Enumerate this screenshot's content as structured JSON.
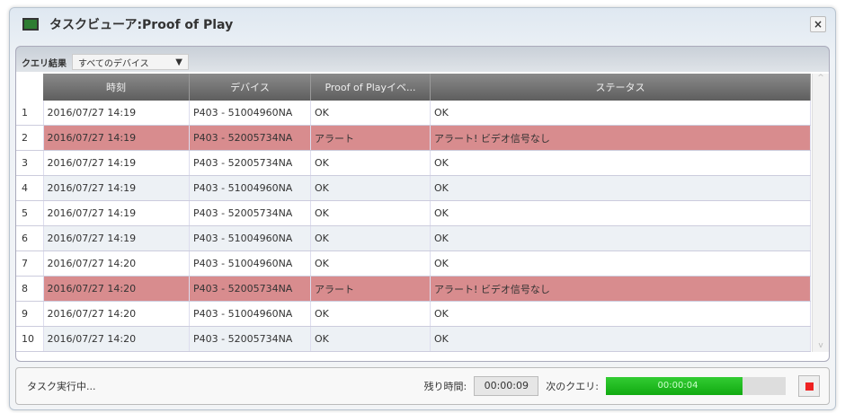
{
  "window": {
    "title": "タスクビューア:Proof of Play",
    "close": "×"
  },
  "toolbar": {
    "label": "クエリ結果",
    "device_select": "すべてのデバイス"
  },
  "table": {
    "headers": [
      "時刻",
      "デバイス",
      "Proof of Playイベ...",
      "ステータス"
    ],
    "rows": [
      {
        "n": "1",
        "time": "2016/07/27 14:19",
        "device": "P403 - 51004960NA",
        "event": "OK",
        "status": "OK",
        "alert": false
      },
      {
        "n": "2",
        "time": "2016/07/27 14:19",
        "device": "P403 - 52005734NA",
        "event": "アラート",
        "status": "アラート! ビデオ信号なし",
        "alert": true
      },
      {
        "n": "3",
        "time": "2016/07/27 14:19",
        "device": "P403 - 52005734NA",
        "event": "OK",
        "status": "OK",
        "alert": false
      },
      {
        "n": "4",
        "time": "2016/07/27 14:19",
        "device": "P403 - 51004960NA",
        "event": "OK",
        "status": "OK",
        "alert": false
      },
      {
        "n": "5",
        "time": "2016/07/27 14:19",
        "device": "P403 - 52005734NA",
        "event": "OK",
        "status": "OK",
        "alert": false
      },
      {
        "n": "6",
        "time": "2016/07/27 14:19",
        "device": "P403 - 51004960NA",
        "event": "OK",
        "status": "OK",
        "alert": false
      },
      {
        "n": "7",
        "time": "2016/07/27 14:20",
        "device": "P403 - 51004960NA",
        "event": "OK",
        "status": "OK",
        "alert": false
      },
      {
        "n": "8",
        "time": "2016/07/27 14:20",
        "device": "P403 - 52005734NA",
        "event": "アラート",
        "status": "アラート! ビデオ信号なし",
        "alert": true
      },
      {
        "n": "9",
        "time": "2016/07/27 14:20",
        "device": "P403 - 51004960NA",
        "event": "OK",
        "status": "OK",
        "alert": false
      },
      {
        "n": "10",
        "time": "2016/07/27 14:20",
        "device": "P403 - 52005734NA",
        "event": "OK",
        "status": "OK",
        "alert": false
      }
    ]
  },
  "status": {
    "text": "タスク実行中...",
    "remaining_label": "残り時間:",
    "remaining": "00:00:09",
    "next_label": "次のクエリ:",
    "next_value": "00:00:04",
    "next_progress": 0.76
  }
}
